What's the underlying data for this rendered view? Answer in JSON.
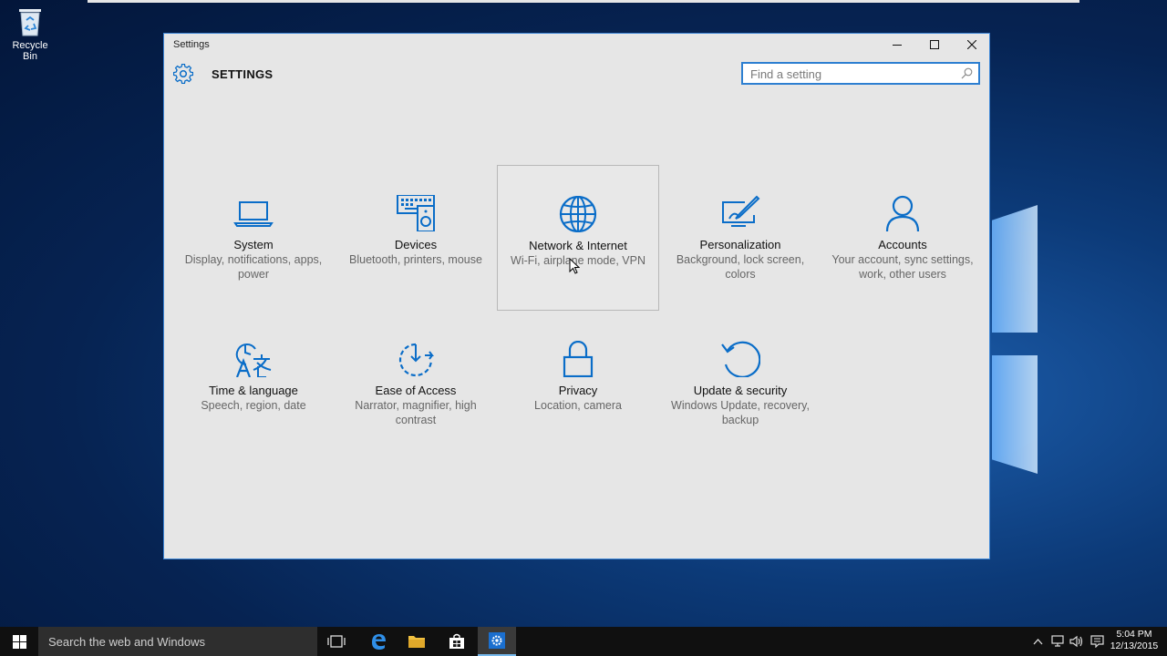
{
  "desktop": {
    "recycle_bin_label": "Recycle Bin"
  },
  "window": {
    "title": "Settings",
    "header_label": "SETTINGS",
    "search_placeholder": "Find a setting",
    "controls": [
      "minimize",
      "maximize",
      "close"
    ]
  },
  "tiles": [
    {
      "name": "System",
      "desc": "Display, notifications, apps, power",
      "icon": "laptop-icon"
    },
    {
      "name": "Devices",
      "desc": "Bluetooth, printers, mouse",
      "icon": "devices-icon"
    },
    {
      "name": "Network & Internet",
      "desc": "Wi-Fi, airplane mode, VPN",
      "icon": "globe-icon"
    },
    {
      "name": "Personalization",
      "desc": "Background, lock screen, colors",
      "icon": "paint-icon"
    },
    {
      "name": "Accounts",
      "desc": "Your account, sync settings, work, other users",
      "icon": "person-icon"
    },
    {
      "name": "Time & language",
      "desc": "Speech, region, date",
      "icon": "time-language-icon"
    },
    {
      "name": "Ease of Access",
      "desc": "Narrator, magnifier, high contrast",
      "icon": "ease-of-access-icon"
    },
    {
      "name": "Privacy",
      "desc": "Location, camera",
      "icon": "lock-icon"
    },
    {
      "name": "Update & security",
      "desc": "Windows Update, recovery, backup",
      "icon": "update-icon"
    }
  ],
  "taskbar": {
    "search_placeholder": "Search the web and Windows",
    "time": "5:04 PM",
    "date": "12/13/2015"
  },
  "colors": {
    "accent": "#0a6dc8",
    "window_bg": "#e6e6e6",
    "taskbar_bg": "#101010"
  }
}
